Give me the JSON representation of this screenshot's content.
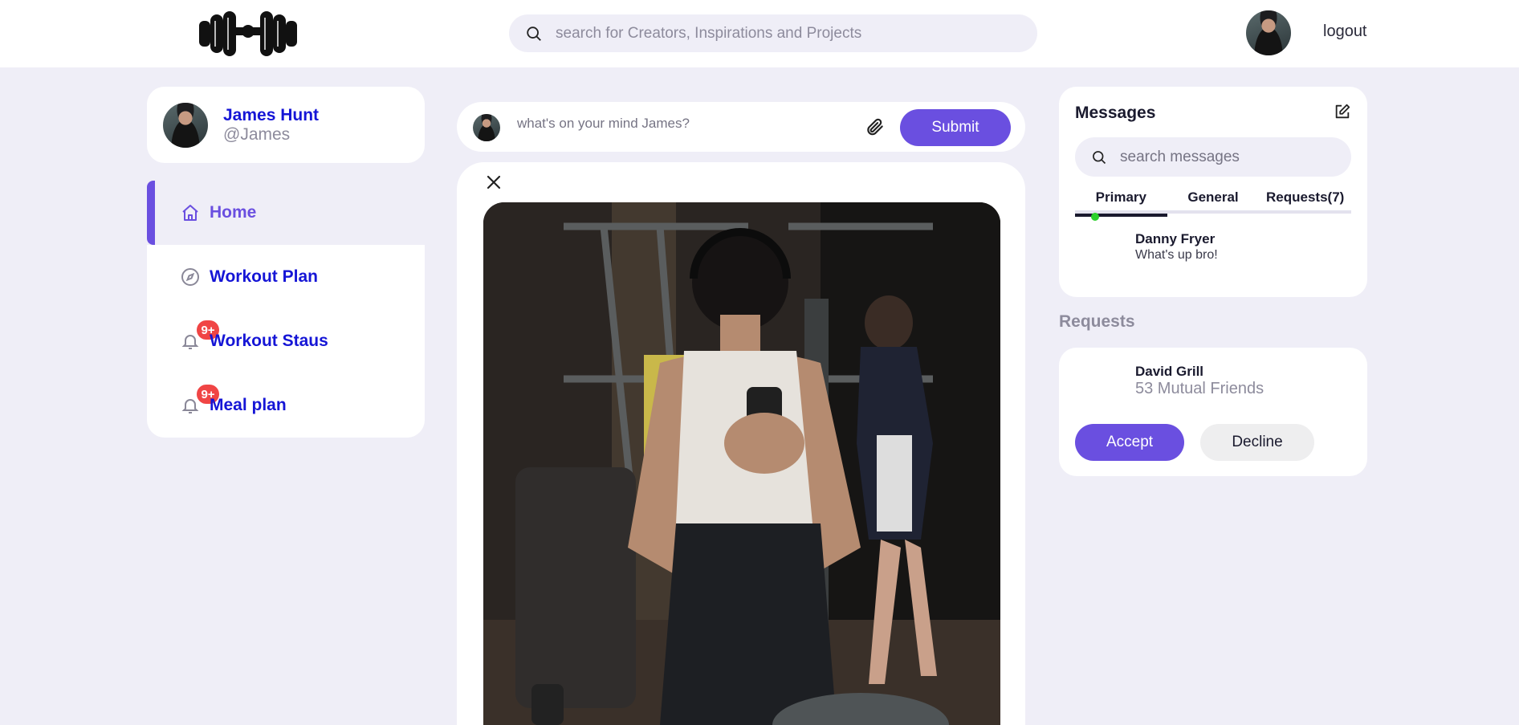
{
  "header": {
    "logo_icon": "dumbbell-icon",
    "search_placeholder": "search for Creators, Inspirations and Projects",
    "logout_label": "logout"
  },
  "profile": {
    "name": "James Hunt",
    "handle": "@James"
  },
  "nav": {
    "items": [
      {
        "label": "Home",
        "icon": "home-icon",
        "active": true
      },
      {
        "label": "Workout Plan",
        "icon": "compass-icon"
      },
      {
        "label": "Workout Staus",
        "icon": "bell-icon",
        "badge": "9+"
      },
      {
        "label": "Meal plan",
        "icon": "bell-icon",
        "badge": "9+"
      }
    ]
  },
  "composer": {
    "placeholder": "what's on your mind James?",
    "attach_icon": "paperclip-icon",
    "submit_label": "Submit"
  },
  "post": {
    "close_icon": "close-icon"
  },
  "messages": {
    "title": "Messages",
    "search_placeholder": "search messages",
    "tabs": [
      {
        "label": "Primary",
        "active": true
      },
      {
        "label": "General"
      },
      {
        "label": "Requests(7)"
      }
    ],
    "items": [
      {
        "from": "Danny Fryer",
        "text": "What's up bro!",
        "online": true
      }
    ]
  },
  "requests": {
    "heading": "Requests",
    "items": [
      {
        "name": "David Grill",
        "mutual": "53 Mutual Friends",
        "accept_label": "Accept",
        "decline_label": "Decline"
      }
    ]
  },
  "colors": {
    "accent": "#6a4fe0",
    "link": "#1515d6",
    "background": "#efeef7",
    "badge": "#f04545",
    "online": "#2bd12b"
  }
}
